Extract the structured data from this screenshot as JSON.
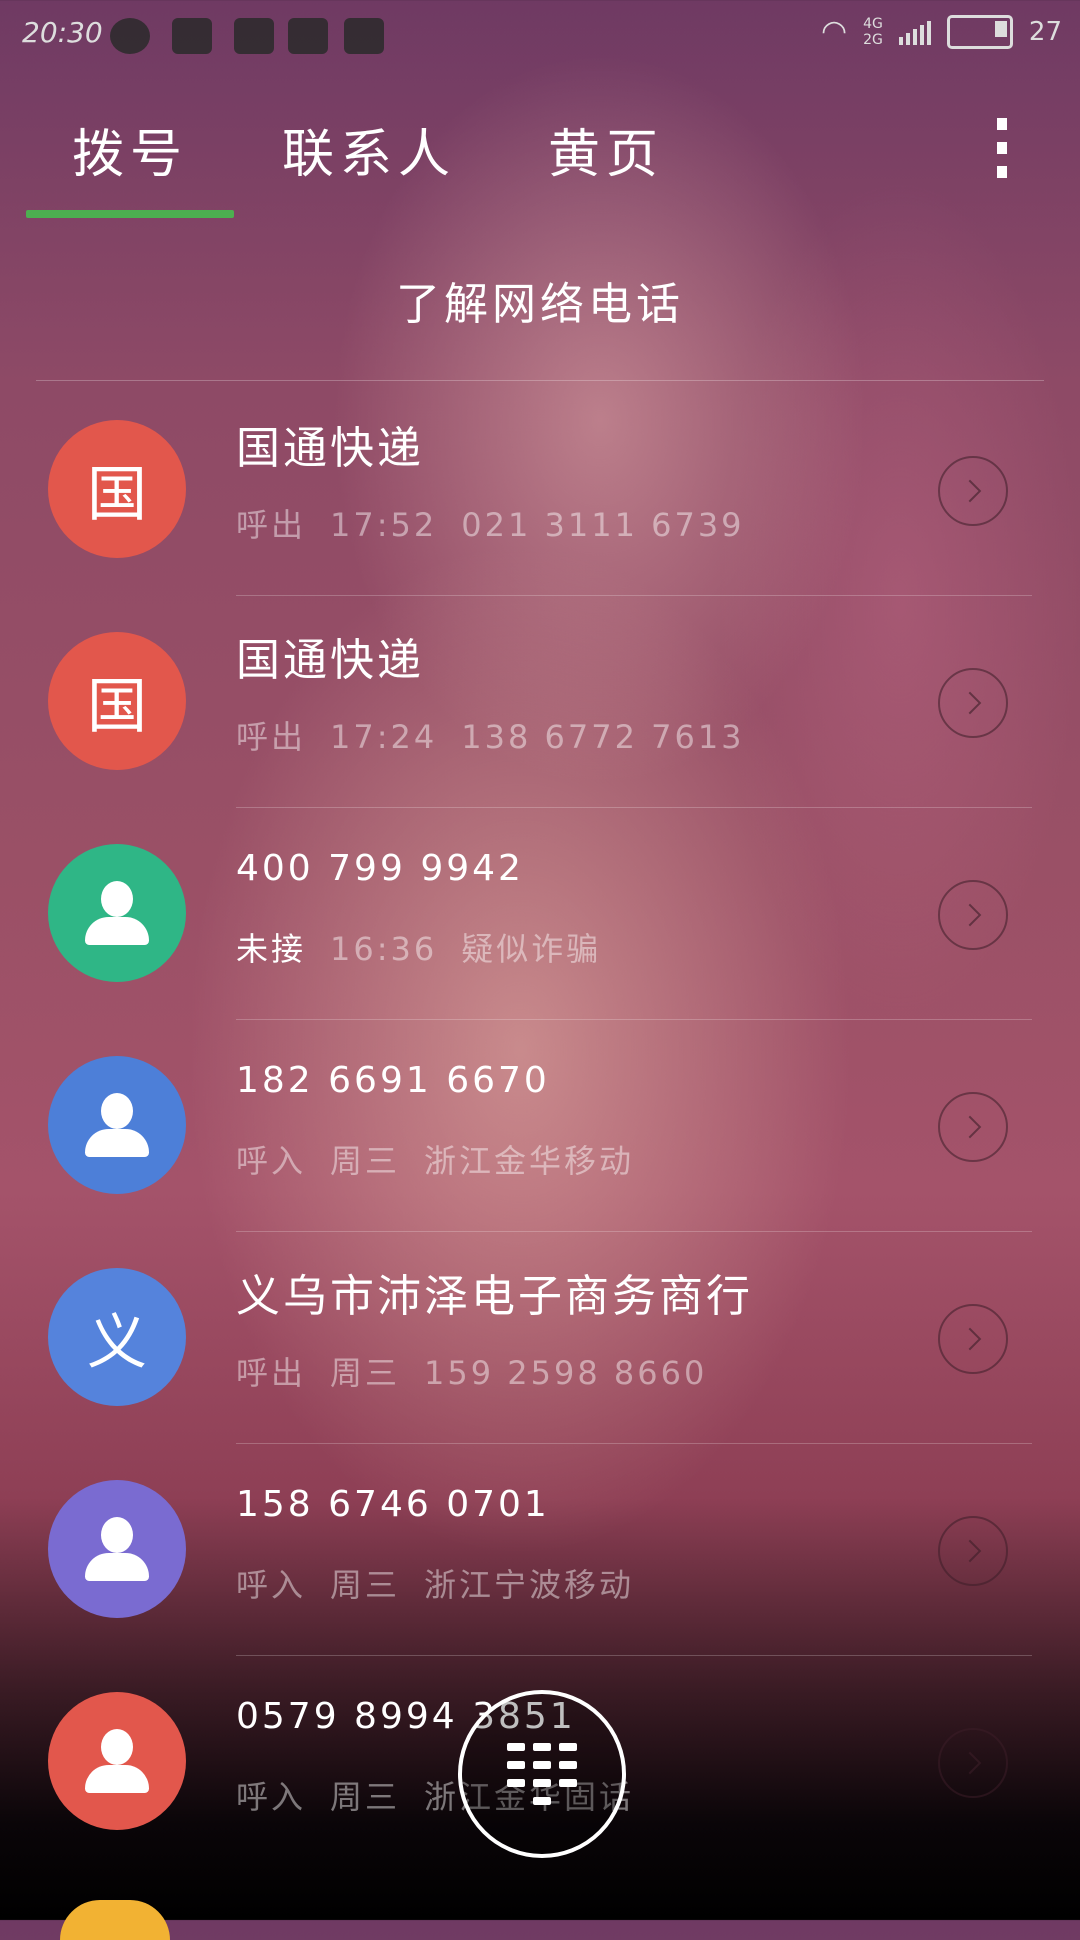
{
  "status_bar": {
    "time": "20:30",
    "icons": [
      "wechat-icon",
      "gallery-icon",
      "qq-icon",
      "news-icon",
      "shield-icon"
    ],
    "network_4g": "4G",
    "network_2g": "2G",
    "battery": "27"
  },
  "tabs": [
    {
      "label": "拨号",
      "active": true
    },
    {
      "label": "联系人",
      "active": false
    },
    {
      "label": "黄页",
      "active": false
    }
  ],
  "accent_color": "#4caf50",
  "banner": {
    "label": "了解网络电话"
  },
  "calls": [
    {
      "avatar_text": "国",
      "avatar_color": "#e2574c",
      "name": "国通快递",
      "type": "呼出",
      "time": "17:52",
      "extra": "021 3111 6739"
    },
    {
      "avatar_text": "国",
      "avatar_color": "#e2574c",
      "name": "国通快递",
      "type": "呼出",
      "time": "17:24",
      "extra": "138 6772 7613"
    },
    {
      "avatar_text": "",
      "avatar_color": "#2fb686",
      "name": "400 799 9942",
      "type": "未接",
      "time": "16:36",
      "extra": "疑似诈骗"
    },
    {
      "avatar_text": "",
      "avatar_color": "#4d7fd8",
      "name": "182 6691 6670",
      "type": "呼入",
      "time": "周三",
      "extra": "浙江金华移动"
    },
    {
      "avatar_text": "义",
      "avatar_color": "#5583dc",
      "name": "义乌市沛泽电子商务商行",
      "type": "呼出",
      "time": "周三",
      "extra": "159 2598 8660"
    },
    {
      "avatar_text": "",
      "avatar_color": "#7a6bd1",
      "name": "158 6746 0701",
      "type": "呼入",
      "time": "周三",
      "extra": "浙江宁波移动"
    },
    {
      "avatar_text": "",
      "avatar_color": "#e2574c",
      "name": "0579 8994 3851",
      "type": "呼入",
      "time": "周三",
      "extra": "浙江金华固话"
    }
  ],
  "next_avatar_color": "#f2b233"
}
